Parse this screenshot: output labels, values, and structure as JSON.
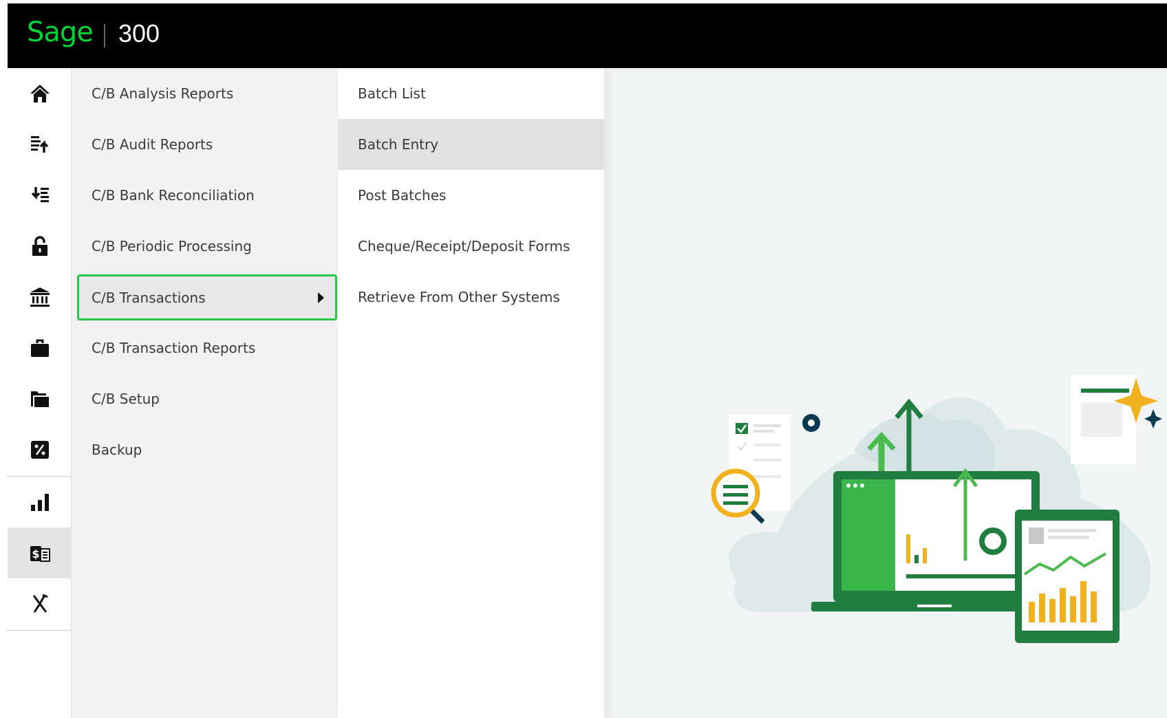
{
  "header": {
    "brand": "Sage",
    "product": "300"
  },
  "iconbar": {
    "items": [
      {
        "icon": "home-icon"
      },
      {
        "icon": "list-upload-icon"
      },
      {
        "icon": "list-download-icon"
      },
      {
        "icon": "unlock-icon"
      },
      {
        "icon": "bank-icon"
      },
      {
        "icon": "briefcase-icon"
      },
      {
        "icon": "folder-icon"
      },
      {
        "icon": "percent-icon"
      },
      {
        "icon": "bar-chart-icon"
      },
      {
        "icon": "cash-book-icon"
      },
      {
        "icon": "tools-icon"
      }
    ]
  },
  "menu1": {
    "items": [
      {
        "label": "C/B Analysis Reports"
      },
      {
        "label": "C/B Audit Reports"
      },
      {
        "label": "C/B Bank Reconciliation"
      },
      {
        "label": "C/B Periodic Processing"
      },
      {
        "label": "C/B Transactions"
      },
      {
        "label": "C/B Transaction Reports"
      },
      {
        "label": "C/B Setup"
      },
      {
        "label": "Backup"
      }
    ]
  },
  "menu2": {
    "items": [
      {
        "label": "Batch List"
      },
      {
        "label": "Batch Entry"
      },
      {
        "label": "Post Batches"
      },
      {
        "label": "Cheque/Receipt/Deposit Forms"
      },
      {
        "label": "Retrieve From Other Systems"
      }
    ]
  },
  "colors": {
    "brand_green": "#00d639",
    "selected_border": "#22c745",
    "topbar": "#000000"
  }
}
